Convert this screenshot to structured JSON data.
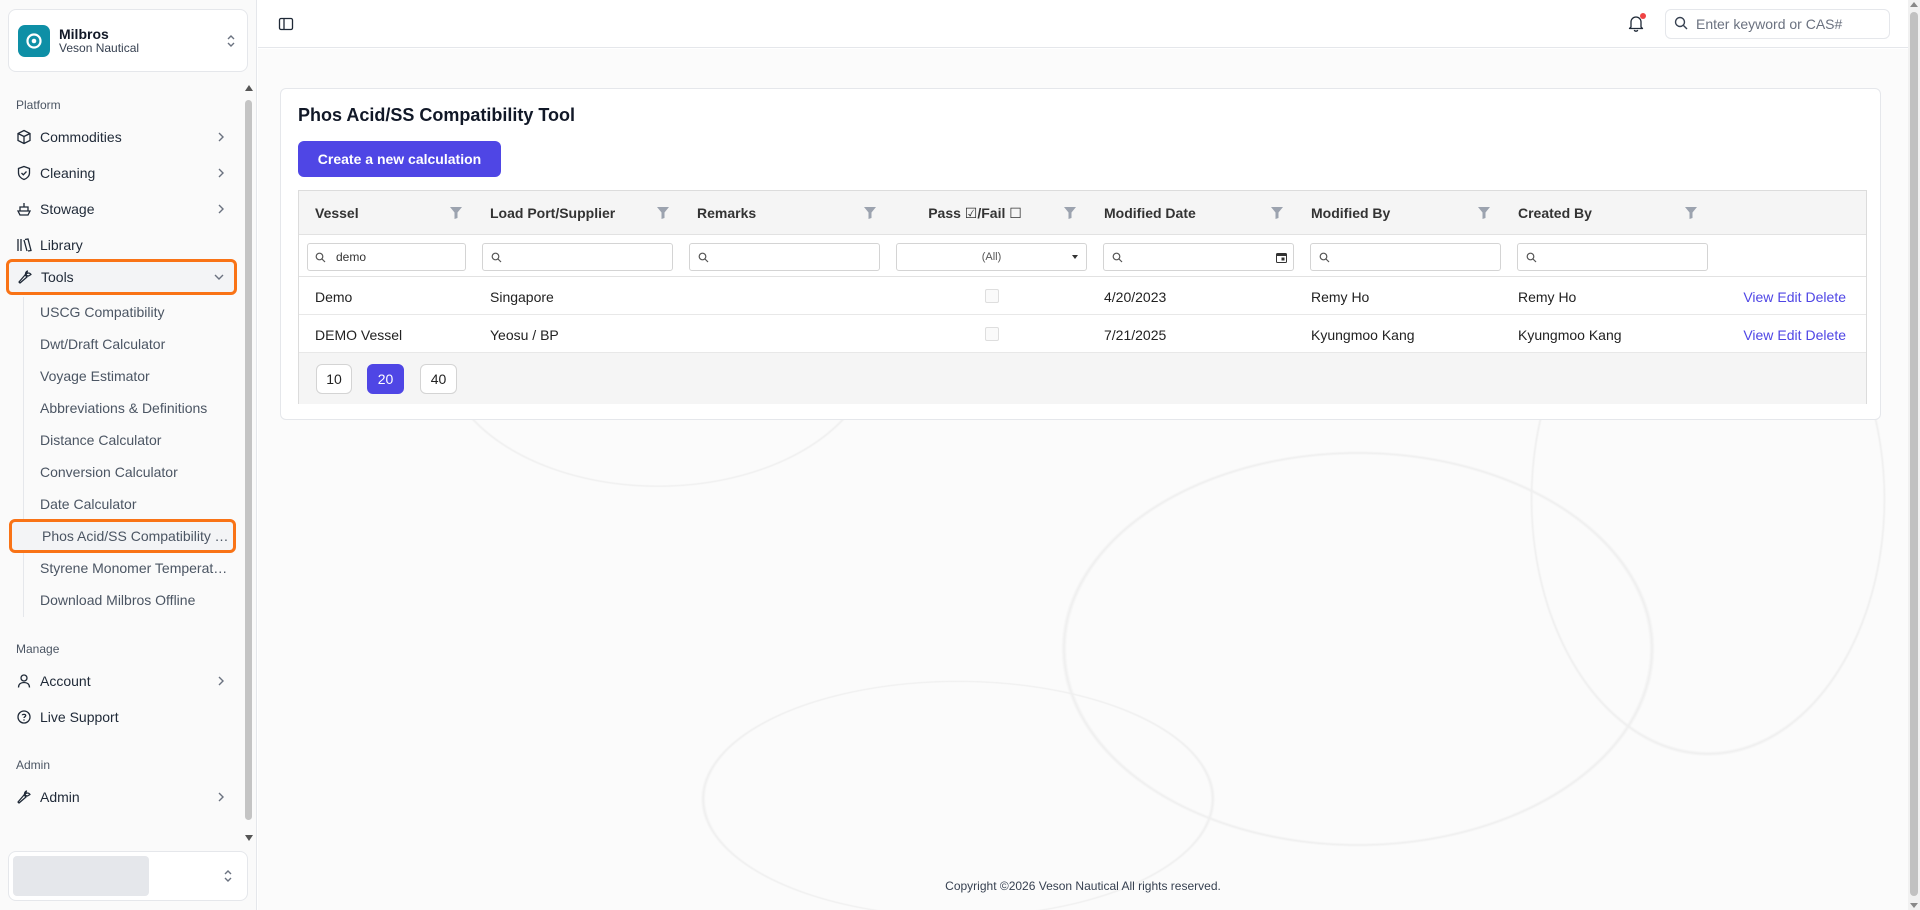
{
  "org": {
    "name": "Milbros",
    "subtitle": "Veson Nautical"
  },
  "sidebar": {
    "platform_label": "Platform",
    "platform_items": [
      {
        "label": "Commodities",
        "icon": "box-icon"
      },
      {
        "label": "Cleaning",
        "icon": "shield-check-icon"
      },
      {
        "label": "Stowage",
        "icon": "ship-icon"
      },
      {
        "label": "Library",
        "icon": "library-icon"
      },
      {
        "label": "Tools",
        "icon": "wrench-icon",
        "expanded": true
      }
    ],
    "tools_items": [
      "USCG Compatibility",
      "Dwt/Draft Calculator",
      "Voyage Estimator",
      "Abbreviations & Definitions",
      "Distance Calculator",
      "Conversion Calculator",
      "Date Calculator",
      "Phos Acid/SS Compatibility Tool",
      "Styrene Monomer Temperature",
      "Download Milbros Offline"
    ],
    "active_tool_index": 7,
    "manage_label": "Manage",
    "manage_items": [
      {
        "label": "Account",
        "icon": "user-icon"
      },
      {
        "label": "Live Support",
        "icon": "support-icon"
      }
    ],
    "admin_label": "Admin",
    "admin_items": [
      {
        "label": "Admin",
        "icon": "wrench-icon"
      }
    ]
  },
  "header": {
    "search_placeholder": "Enter keyword or CAS#",
    "has_notification": true
  },
  "page": {
    "title": "Phos Acid/SS Compatibility Tool",
    "create_button": "Create a new calculation"
  },
  "table": {
    "columns": [
      "Vessel",
      "Load Port/Supplier",
      "Remarks",
      "Pass ☑/Fail ☐",
      "Modified Date",
      "Modified By",
      "Created By"
    ],
    "filters": {
      "vessel": "demo",
      "load_port": "",
      "remarks": "",
      "pass_fail": "(All)",
      "modified_date": "",
      "modified_by": "",
      "created_by": ""
    },
    "rows": [
      {
        "vessel": "Demo",
        "load_port": "Singapore",
        "remarks": "",
        "pass": false,
        "modified_date": "4/20/2023",
        "modified_by": "Remy Ho",
        "created_by": "Remy Ho"
      },
      {
        "vessel": "DEMO Vessel",
        "load_port": "Yeosu / BP",
        "remarks": "",
        "pass": false,
        "modified_date": "7/21/2025",
        "modified_by": "Kyungmoo Kang",
        "created_by": "Kyungmoo Kang"
      }
    ],
    "actions": {
      "view": "View",
      "edit": "Edit",
      "delete": "Delete"
    },
    "page_sizes": [
      "10",
      "20",
      "40"
    ],
    "active_page_size": "20"
  },
  "footer": {
    "copyright": "Copyright ©2026 Veson Nautical All rights reserved."
  },
  "colors": {
    "accent": "#4f46e5",
    "highlight": "#f97316",
    "logo": "#0e8fa6"
  }
}
